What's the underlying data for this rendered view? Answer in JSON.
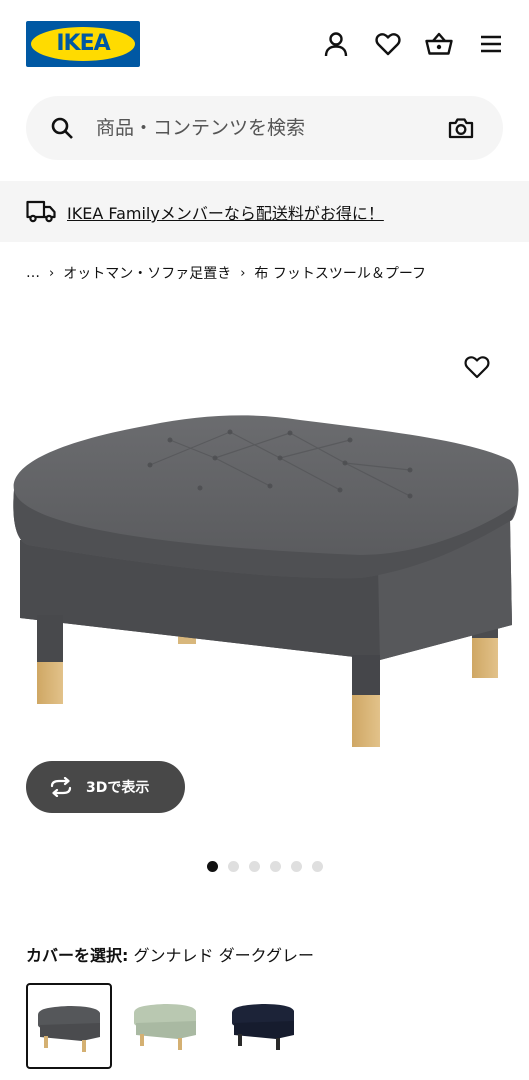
{
  "header": {
    "logo_text": "IKEA",
    "icons": [
      "account-icon",
      "heart-icon",
      "basket-icon",
      "menu-icon"
    ]
  },
  "search": {
    "placeholder": "商品・コンテンツを検索"
  },
  "banner": {
    "text": "IKEA Familyメンバーなら配送料がお得に！"
  },
  "breadcrumb": {
    "items": [
      "…",
      "オットマン・ソファ足置き",
      "布 フットスツール＆プーフ"
    ]
  },
  "product": {
    "view_3d_label": "3Dで表示",
    "image_count": 6,
    "active_image": 1
  },
  "cover": {
    "label": "カバーを選択:",
    "selected_name": "グンナレド ダークグレー",
    "options": [
      {
        "color": "#55575a"
      },
      {
        "color": "#b9c8b1"
      },
      {
        "color": "#1c2338"
      }
    ]
  },
  "colors": {
    "brand_blue": "#0058a3",
    "brand_yellow": "#ffdb00",
    "button_dark": "#484848",
    "surface_grey": "#f5f5f5"
  }
}
